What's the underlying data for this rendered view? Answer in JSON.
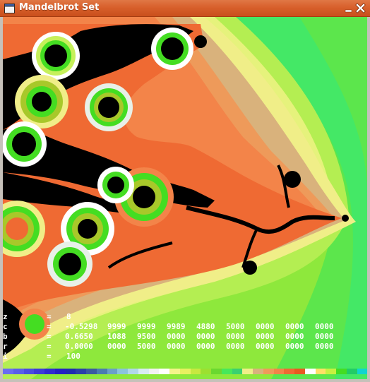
{
  "window": {
    "title": "Mandelbrot Set"
  },
  "icons": {
    "app": "window-app-icon",
    "minimize": "minimize-icon",
    "close": "close-icon"
  },
  "overlay": {
    "rows": [
      {
        "key": "z",
        "eq": "=",
        "value": "8",
        "cells": []
      },
      {
        "key": "c",
        "eq": "=",
        "value": "",
        "cells": [
          "-0.5298",
          "9999",
          "9999",
          "9989",
          "4880",
          "5000",
          "0000",
          "0000",
          "0000"
        ]
      },
      {
        "key": "b",
        "eq": "=",
        "value": "",
        "cells": [
          "0.6650",
          "1088",
          "9500",
          "0000",
          "0000",
          "0000",
          "0000",
          "0000",
          "0000"
        ]
      },
      {
        "key": "r",
        "eq": "=",
        "value": "",
        "cells": [
          "0.0000",
          "0000",
          "5000",
          "0000",
          "0000",
          "0000",
          "0000",
          "0000",
          "0000"
        ]
      },
      {
        "key": "i",
        "eq": "=",
        "value": "100",
        "cells": []
      }
    ]
  },
  "colors": {
    "titlebar": "#d8602c",
    "inside": "#000000",
    "far": "#46e85a",
    "band_1": "#8fe53a",
    "band_2": "#c6f05a",
    "band_3": "#e9f27a",
    "band_4": "#f0ee88",
    "band_5": "#d9b27c",
    "band_6": "#ee9a5a",
    "band_7": "#f38449",
    "band_8": "#ef6a33",
    "band_9": "#e8f0e8",
    "band_10": "#44dd22",
    "band_11": "#a8c82a"
  },
  "palette": [
    "#6a6cf0",
    "#5a5ee8",
    "#4a4ce0",
    "#3d3bd8",
    "#2f2bd0",
    "#2321c4",
    "#1e2cb0",
    "#2a40a8",
    "#3a5aa0",
    "#4a7cb0",
    "#6aa0c8",
    "#8ac4dc",
    "#b0d8e8",
    "#d8ecf2",
    "#f2f2f2",
    "#ffffff",
    "#f4f48a",
    "#e8f060",
    "#c8e840",
    "#9ce030",
    "#6ad830",
    "#46e85a",
    "#3ad070",
    "#f0ee88",
    "#d9b27c",
    "#ee9a5a",
    "#f38449",
    "#ef6a33",
    "#e85a20",
    "#ffffff",
    "#ffe066",
    "#c8f040",
    "#44dd22",
    "#22cc66",
    "#11d4d0"
  ]
}
